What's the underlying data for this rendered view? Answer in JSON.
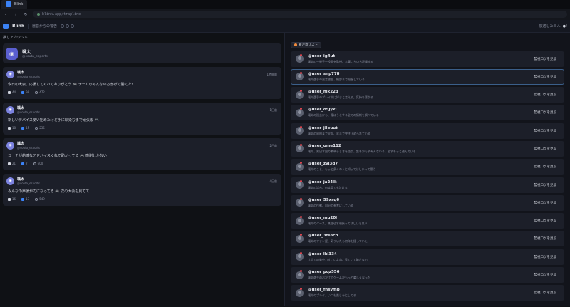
{
  "browser": {
    "tab_title": "Blink",
    "url": "blink.app/trapline"
  },
  "header": {
    "brand": "Blink",
    "subtitle": "運営からの警告",
    "right_text": "放送した日人",
    "right_badge": "●!"
  },
  "left": {
    "section_title": "推しアカウント",
    "profile": {
      "name": "颯太",
      "handle": "@souta_esports",
      "avatar_icon": "gamepad-icon"
    },
    "posts": [
      {
        "name": "颯太",
        "handle": "@souta_esports",
        "time": "1時間前",
        "text": "今日の大会、応援してくれてありがとう",
        "text2": "チームのみんなのおかげで勝てた!",
        "emoji": "🎮",
        "stats": [
          "44",
          "98",
          "472"
        ]
      },
      {
        "name": "颯太",
        "handle": "@souta_esports",
        "time": "1日前",
        "text": "新しいデバイス使い始めたけど手に馴染むまで頑張る",
        "text2": "",
        "emoji": "🎮",
        "stats": [
          "18",
          "15",
          "235"
        ]
      },
      {
        "name": "颯太",
        "handle": "@souta_esports",
        "time": "2日前",
        "text": "コーチが的確なアドバイスくれて助かってる",
        "text2": "感謝しかない",
        "emoji": "🎮",
        "stats": [
          "21",
          "7",
          "600"
        ]
      },
      {
        "name": "颯太",
        "handle": "@souta_esports",
        "time": "4日前",
        "text": "みんなの声援が力になってる",
        "text2": "次の大会も見てて!",
        "emoji": "🎮",
        "stats": [
          "16",
          "17",
          "549"
        ]
      }
    ]
  },
  "right": {
    "badge": "要注意リスト",
    "button_label": "監視ログを見る",
    "users": [
      {
        "handle": "@user_ig4ut",
        "desc": "颯太の一挙手一投足を監視、言葉いちいち記録する"
      },
      {
        "handle": "@user_snp778",
        "desc": "颯太選手の発言履歴、細部まで把握している"
      },
      {
        "handle": "@user_hjk223",
        "desc": "颯太選手のプレイ中に好きと言える。気持ち悪がる"
      },
      {
        "handle": "@user_o5jyki",
        "desc": "颯太の過去から、隠ぼうとする全ての情報を調べている"
      },
      {
        "handle": "@user_j8euut",
        "desc": "颯太の周囲まで全部、家まで突き止められている"
      },
      {
        "handle": "@user_gme112",
        "desc": "颯太、来日本国の素晴らしさを語り、誰もかもずみんないる。必ずもっと遊んでいる"
      },
      {
        "handle": "@user_zvl3d7",
        "desc": "颯太のこと、もっと多くの人に知ってほしいって思う"
      },
      {
        "handle": "@user_ja24lk",
        "desc": "颯太の試合、何度見ても泣ける"
      },
      {
        "handle": "@user_59xsq6",
        "desc": "颯太の作戦、自分の参考にしている"
      },
      {
        "handle": "@user_mu20l",
        "desc": "颯太のペース、無理せず頑張ってほしいと思う"
      },
      {
        "handle": "@user_3fs8cp",
        "desc": "颯太のファン歴、気づいたら何年も経っていた"
      },
      {
        "handle": "@user_lkl334",
        "desc": "大会での集中力すごいよね、見ていて飽きない"
      },
      {
        "handle": "@user_pqz556",
        "desc": "颯太選手のおかげでゲームがもっと楽しくなった"
      },
      {
        "handle": "@user_fnsvmb",
        "desc": "颯太のプレイ、いつも楽しみにしてる"
      }
    ],
    "selected_index": 1
  }
}
